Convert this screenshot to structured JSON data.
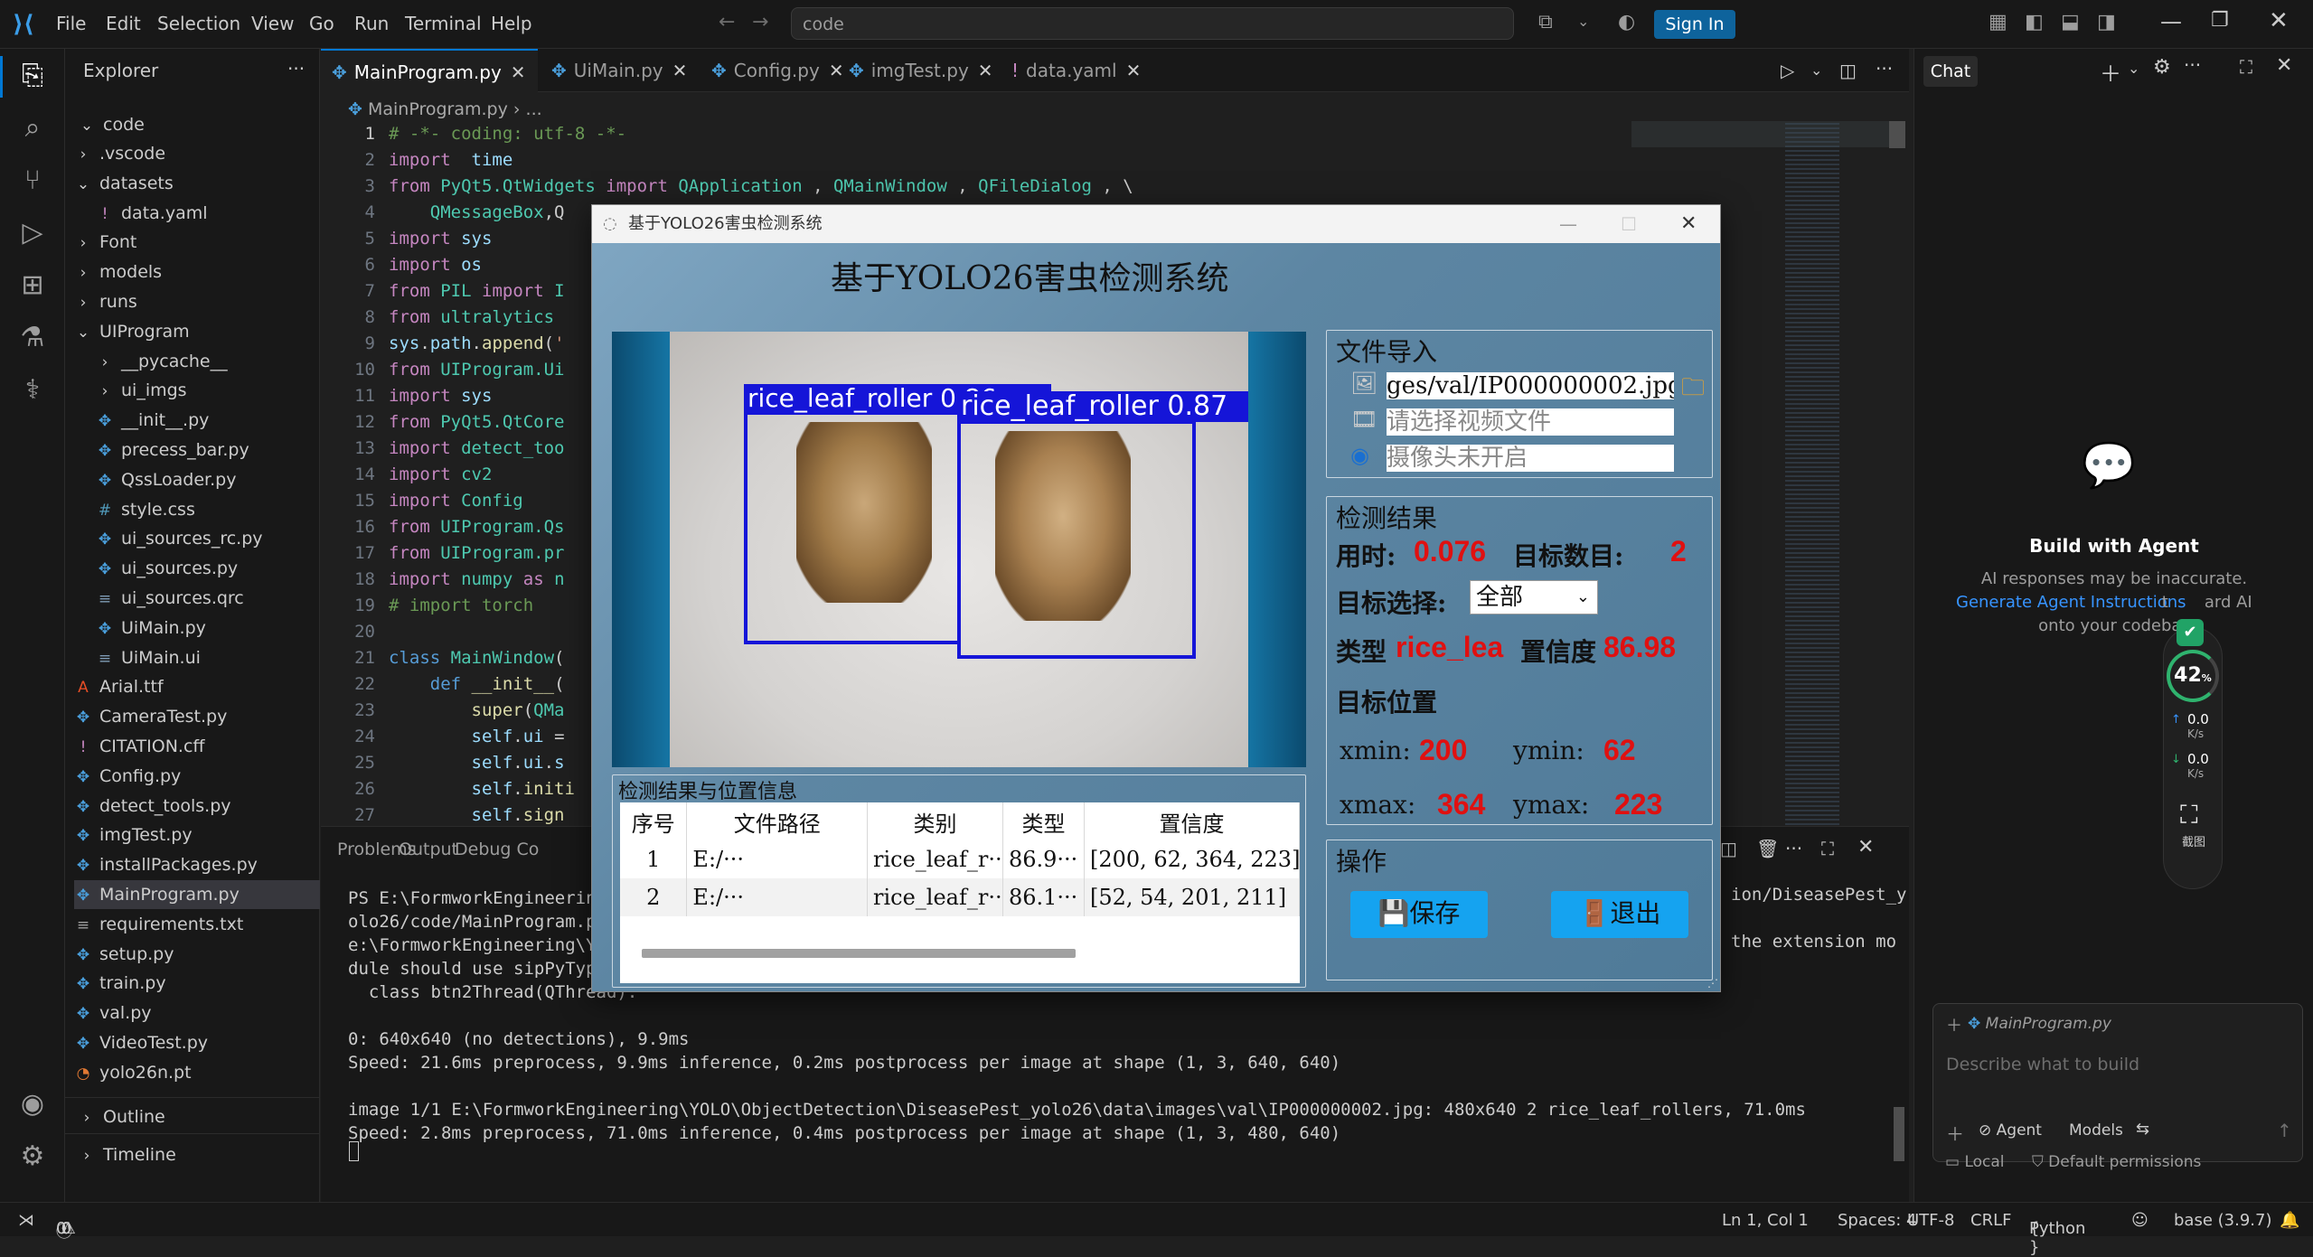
{
  "titlebar": {
    "menus": [
      "File",
      "Edit",
      "Selection",
      "View",
      "Go",
      "Run",
      "Terminal",
      "Help"
    ],
    "search_text": "code",
    "sign_in": "Sign In"
  },
  "explorer": {
    "header": "Explorer",
    "root": "code",
    "items": [
      {
        "label": ".vscode",
        "type": "folder",
        "depth": 1
      },
      {
        "label": "datasets",
        "type": "folder-open",
        "depth": 1
      },
      {
        "label": "data.yaml",
        "type": "yaml",
        "depth": 2
      },
      {
        "label": "Font",
        "type": "folder",
        "depth": 1
      },
      {
        "label": "models",
        "type": "folder",
        "depth": 1
      },
      {
        "label": "runs",
        "type": "folder",
        "depth": 1
      },
      {
        "label": "UIProgram",
        "type": "folder-open",
        "depth": 1
      },
      {
        "label": "__pycache__",
        "type": "folder",
        "depth": 2
      },
      {
        "label": "ui_imgs",
        "type": "folder",
        "depth": 2
      },
      {
        "label": "__init__.py",
        "type": "py",
        "depth": 2
      },
      {
        "label": "precess_bar.py",
        "type": "py",
        "depth": 2
      },
      {
        "label": "QssLoader.py",
        "type": "py",
        "depth": 2
      },
      {
        "label": "style.css",
        "type": "css",
        "depth": 2
      },
      {
        "label": "ui_sources_rc.py",
        "type": "py",
        "depth": 2
      },
      {
        "label": "ui_sources.py",
        "type": "py",
        "depth": 2
      },
      {
        "label": "ui_sources.qrc",
        "type": "other",
        "depth": 2
      },
      {
        "label": "UiMain.py",
        "type": "py",
        "depth": 2
      },
      {
        "label": "UiMain.ui",
        "type": "other",
        "depth": 2
      },
      {
        "label": "Arial.ttf",
        "type": "font",
        "depth": 1
      },
      {
        "label": "CameraTest.py",
        "type": "py",
        "depth": 1
      },
      {
        "label": "CITATION.cff",
        "type": "yaml",
        "depth": 1
      },
      {
        "label": "Config.py",
        "type": "py",
        "depth": 1
      },
      {
        "label": "detect_tools.py",
        "type": "py",
        "depth": 1
      },
      {
        "label": "imgTest.py",
        "type": "py",
        "depth": 1
      },
      {
        "label": "installPackages.py",
        "type": "py",
        "depth": 1
      },
      {
        "label": "MainProgram.py",
        "type": "py",
        "depth": 1,
        "selected": true
      },
      {
        "label": "requirements.txt",
        "type": "txt",
        "depth": 1
      },
      {
        "label": "setup.py",
        "type": "py",
        "depth": 1
      },
      {
        "label": "train.py",
        "type": "py",
        "depth": 1
      },
      {
        "label": "val.py",
        "type": "py",
        "depth": 1
      },
      {
        "label": "VideoTest.py",
        "type": "py",
        "depth": 1
      },
      {
        "label": "yolo26n.pt",
        "type": "rss",
        "depth": 1
      }
    ],
    "outline": "Outline",
    "timeline": "Timeline"
  },
  "editor": {
    "tabs": [
      {
        "label": "MainProgram.py",
        "active": true,
        "icon": "py"
      },
      {
        "label": "UiMain.py",
        "icon": "py"
      },
      {
        "label": "Config.py",
        "icon": "py"
      },
      {
        "label": "imgTest.py",
        "icon": "py"
      },
      {
        "label": "data.yaml",
        "icon": "yaml"
      }
    ],
    "breadcrumb": [
      "MainProgram.py",
      "..."
    ],
    "lines": [
      [
        [
          "cm",
          "# -*- coding: utf-8 -*-"
        ]
      ],
      [
        [
          "kw",
          "import"
        ],
        [
          "",
          "  "
        ],
        [
          "id",
          "time"
        ]
      ],
      [
        [
          "kw",
          "from"
        ],
        [
          "",
          " "
        ],
        [
          "cl",
          "PyQt5.QtWidgets"
        ],
        [
          "",
          " "
        ],
        [
          "kw",
          "import"
        ],
        [
          "",
          " "
        ],
        [
          "cl",
          "QApplication"
        ],
        [
          "",
          " , "
        ],
        [
          "cl",
          "QMainWindow"
        ],
        [
          "",
          " , "
        ],
        [
          "cl",
          "QFileDialog"
        ],
        [
          "",
          " , \\"
        ]
      ],
      [
        [
          "",
          " "
        ],
        [
          "cl",
          "   QMessageBox"
        ],
        [
          "",
          ",Q"
        ]
      ],
      [
        [
          "kw",
          "import"
        ],
        [
          "",
          " "
        ],
        [
          "id",
          "sys"
        ]
      ],
      [
        [
          "kw",
          "import"
        ],
        [
          "",
          " "
        ],
        [
          "id",
          "os"
        ]
      ],
      [
        [
          "kw",
          "from"
        ],
        [
          "",
          " "
        ],
        [
          "cl",
          "PIL"
        ],
        [
          "",
          " "
        ],
        [
          "kw",
          "import"
        ],
        [
          "",
          " "
        ],
        [
          "cl",
          "I"
        ]
      ],
      [
        [
          "kw",
          "from"
        ],
        [
          "",
          " "
        ],
        [
          "cl",
          "ultralytics"
        ]
      ],
      [
        [
          "id",
          "sys"
        ],
        [
          "",
          "."
        ],
        [
          "id",
          "path"
        ],
        [
          "",
          "."
        ],
        [
          "fn",
          "append"
        ],
        [
          "",
          "("
        ],
        [
          "st",
          "'"
        ]
      ],
      [
        [
          "kw",
          "from"
        ],
        [
          "",
          " "
        ],
        [
          "cl",
          "UIProgram.Ui"
        ]
      ],
      [
        [
          "kw",
          "import"
        ],
        [
          "",
          " "
        ],
        [
          "id",
          "sys"
        ]
      ],
      [
        [
          "kw",
          "from"
        ],
        [
          "",
          " "
        ],
        [
          "cl",
          "PyQt5.QtCore"
        ]
      ],
      [
        [
          "kw",
          "import"
        ],
        [
          "",
          " "
        ],
        [
          "cl",
          "detect_too"
        ]
      ],
      [
        [
          "kw",
          "import"
        ],
        [
          "",
          " "
        ],
        [
          "cl",
          "cv2"
        ]
      ],
      [
        [
          "kw",
          "import"
        ],
        [
          "",
          " "
        ],
        [
          "cl",
          "Config"
        ]
      ],
      [
        [
          "kw",
          "from"
        ],
        [
          "",
          " "
        ],
        [
          "cl",
          "UIProgram.Qs"
        ]
      ],
      [
        [
          "kw",
          "from"
        ],
        [
          "",
          " "
        ],
        [
          "cl",
          "UIProgram.pr"
        ]
      ],
      [
        [
          "kw",
          "import"
        ],
        [
          "",
          " "
        ],
        [
          "cl",
          "numpy"
        ],
        [
          "",
          " "
        ],
        [
          "kw",
          "as"
        ],
        [
          "",
          " "
        ],
        [
          "cl",
          "n"
        ]
      ],
      [
        [
          "cm",
          "# import torch"
        ]
      ],
      [
        [
          "",
          ""
        ]
      ],
      [
        [
          "kw2",
          "class"
        ],
        [
          "",
          " "
        ],
        [
          "cl",
          "MainWindow"
        ],
        [
          "",
          "("
        ]
      ],
      [
        [
          "",
          "    "
        ],
        [
          "kw2",
          "def"
        ],
        [
          "",
          " "
        ],
        [
          "fn",
          "__init__"
        ],
        [
          "",
          "("
        ]
      ],
      [
        [
          "",
          "        "
        ],
        [
          "fn",
          "super"
        ],
        [
          "",
          "("
        ],
        [
          "cl",
          "QMa"
        ]
      ],
      [
        [
          "",
          "        "
        ],
        [
          "id",
          "self"
        ],
        [
          "",
          "."
        ],
        [
          "id",
          "ui"
        ],
        [
          "",
          " ="
        ]
      ],
      [
        [
          "",
          "        "
        ],
        [
          "id",
          "self"
        ],
        [
          "",
          "."
        ],
        [
          "id",
          "ui"
        ],
        [
          "",
          "."
        ],
        [
          "id",
          "s"
        ]
      ],
      [
        [
          "",
          "        "
        ],
        [
          "id",
          "self"
        ],
        [
          "",
          "."
        ],
        [
          "fn",
          "initi"
        ]
      ],
      [
        [
          "",
          "        "
        ],
        [
          "id",
          "self"
        ],
        [
          "",
          "."
        ],
        [
          "fn",
          "sign"
        ]
      ]
    ]
  },
  "panel": {
    "tabs": [
      "Problems",
      "Output",
      "Debug Co"
    ],
    "terminal": [
      "PS E:\\FormworkEngineering",
      "olo26/code/MainProgram.py",
      "e:\\FormworkEngineering\\YO",
      "dule should use sipPyType",
      "  class btn2Thread(QThread):",
      "",
      "0: 640x640 (no detections), 9.9ms",
      "Speed: 21.6ms preprocess, 9.9ms inference, 0.2ms postprocess per image at shape (1, 3, 640, 640)",
      "",
      "image 1/1 E:\\FormworkEngineering\\YOLO\\ObjectDetection\\DiseasePest_yolo26\\data\\images\\val\\IP000000002.jpg: 480x640 2 rice_leaf_rollers, 71.0ms",
      "Speed: 2.8ms preprocess, 71.0ms inference, 0.4ms postprocess per image at shape (1, 3, 480, 640)"
    ],
    "right_fragments": [
      "ion/DiseasePest_y",
      "the extension mo"
    ]
  },
  "chat": {
    "title": "Chat",
    "heading": "Build with Agent",
    "line1": "AI responses may be inaccurate.",
    "link": "Generate Agent Instructions",
    "line2_suffix": " t       ard AI",
    "line3": "onto your codebas",
    "context_file": "MainProgram.py",
    "placeholder": "Describe what to build",
    "agent_label": "Agent",
    "models_label": "Models",
    "local_label": "Local",
    "permissions_label": "Default permissions",
    "widget_percent": "42",
    "widget_up": "0.0",
    "widget_down": "0.0",
    "widget_unit": "K/s",
    "widget_shot": "截图"
  },
  "status": {
    "errors": "0",
    "warnings": "0",
    "position": "Ln 1, Col 1",
    "spaces": "Spaces: 4",
    "encoding": "UTF-8",
    "eol": "CRLF",
    "language": "Python",
    "env": "base (3.9.7)"
  },
  "app": {
    "window_title": "基于YOLO26害虫检测系统",
    "heading": "基于YOLO26害虫检测系统",
    "det_labels": [
      "rice_leaf_roller 0.86",
      "rice_leaf_roller 0.87"
    ],
    "file_import_title": "文件导入",
    "image_path": "ges/val/IP000000002.jpg",
    "video_placeholder": "请选择视频文件",
    "camera_status": "摄像头未开启",
    "result_title": "检测结果",
    "time_label": "用时:",
    "time_value": "0.076",
    "count_label": "目标数目:",
    "count_value": "2",
    "select_label": "目标选择:",
    "select_value": "全部",
    "type_label": "类型",
    "type_value": "rice_lea",
    "conf_label": "置信度",
    "conf_value": "86.98",
    "pos_title": "目标位置",
    "xmin_label": "xmin:",
    "xmin_value": "200",
    "ymin_label": "ymin:",
    "ymin_value": "62",
    "xmax_label": "xmax:",
    "xmax_value": "364",
    "ymax_label": "ymax:",
    "ymax_value": "223",
    "table_title": "检测结果与位置信息",
    "table_headers": [
      "序号",
      "文件路径",
      "类别",
      "类型",
      "置信度"
    ],
    "table_rows": [
      [
        "1",
        "E:/···",
        "rice_leaf_r···",
        "86.9···",
        "[200, 62, 364, 223]"
      ],
      [
        "2",
        "E:/···",
        "rice_leaf_r···",
        "86.1···",
        "[52, 54, 201, 211]"
      ]
    ],
    "ops_title": "操作",
    "save_label": "保存",
    "exit_label": "退出"
  }
}
